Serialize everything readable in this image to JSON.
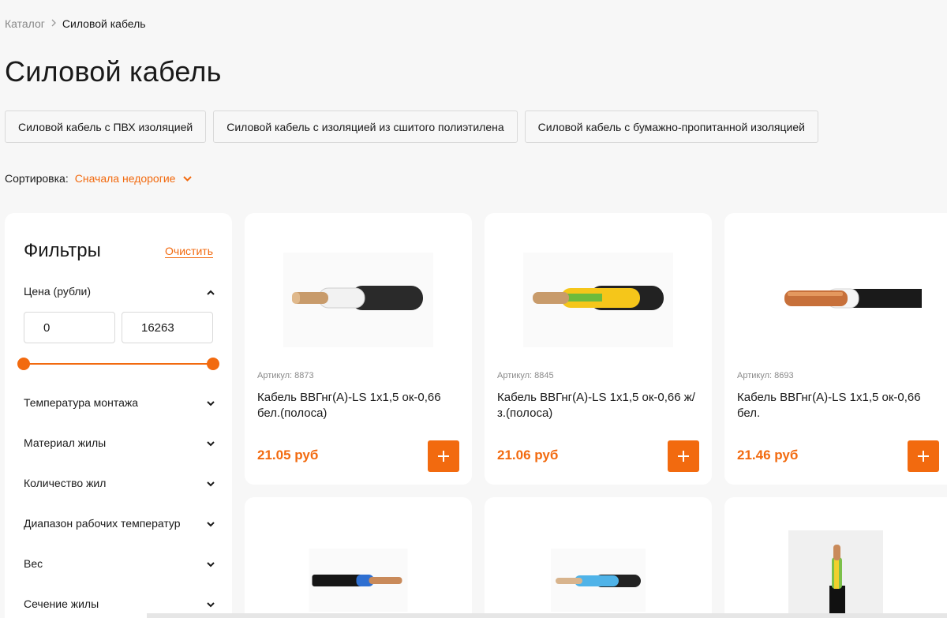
{
  "breadcrumb": {
    "root": "Каталог",
    "current": "Силовой кабель"
  },
  "page_title": "Силовой кабель",
  "subcategories": [
    "Силовой кабель с ПВХ изоляцией",
    "Силовой кабель с изоляцией из сшитого полиэтилена",
    "Силовой кабель с бумажно-пропитанной изоляцией"
  ],
  "sort": {
    "label": "Сортировка:",
    "value": "Сначала недорогие"
  },
  "filters": {
    "title": "Фильтры",
    "clear": "Очистить",
    "price": {
      "label": "Цена (рубли)",
      "min": "0",
      "max": "16263"
    },
    "groups": [
      "Температура монтажа",
      "Материал жилы",
      "Количество жил",
      "Диапазон рабочих температур",
      "Вес",
      "Сечение жилы"
    ]
  },
  "products": [
    {
      "sku": "Артикул: 8873",
      "title": "Кабель ВВГнг(А)-LS 1х1,5 ок-0,66 бел.(полоса)",
      "price": "21.05 руб"
    },
    {
      "sku": "Артикул: 8845",
      "title": "Кабель ВВГнг(А)-LS 1х1,5 ок-0,66 ж/з.(полоса)",
      "price": "21.06 руб"
    },
    {
      "sku": "Артикул: 8693",
      "title": "Кабель ВВГнг(А)-LS 1х1,5 ок-0,66 бел.",
      "price": "21.46 руб"
    }
  ],
  "colors": {
    "accent": "#f26a0f",
    "background": "#f7f7f7"
  },
  "icons": [
    "chevron-right-icon",
    "chevron-down-icon",
    "chevron-up-icon",
    "plus-icon"
  ]
}
